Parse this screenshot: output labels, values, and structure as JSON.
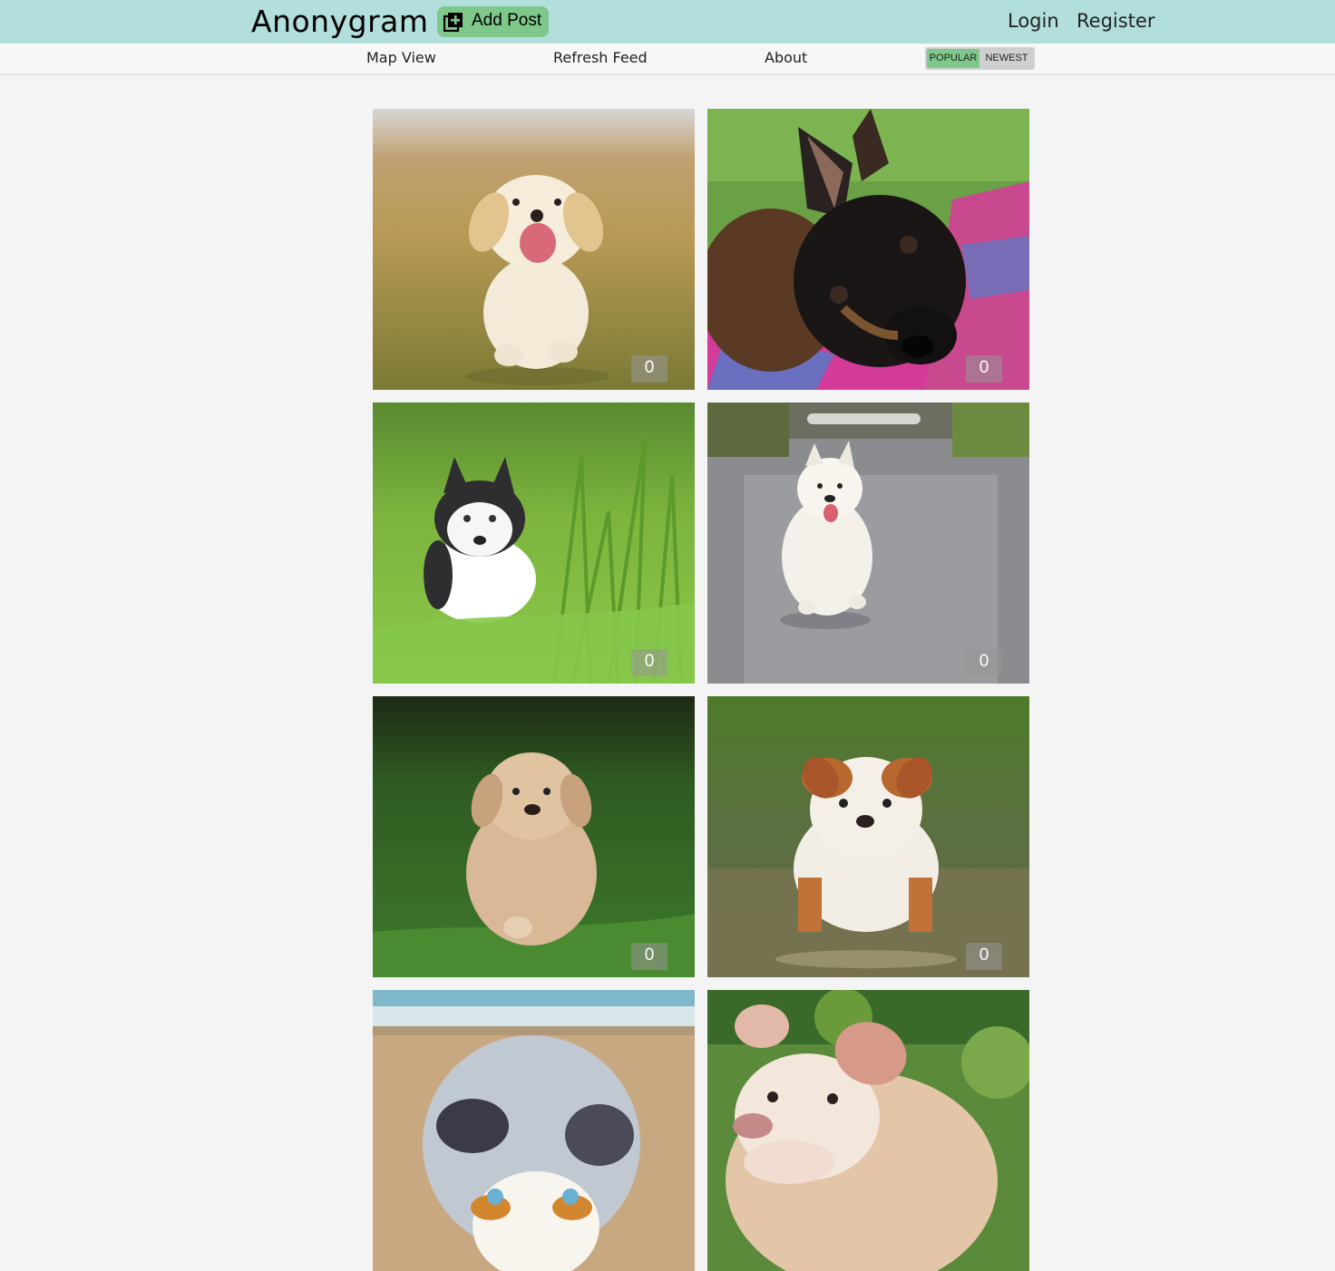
{
  "header": {
    "brand": "Anonygram",
    "add_post_label": "Add Post",
    "add_post_icon": "add-box-icon",
    "login_label": "Login",
    "register_label": "Register",
    "background": "#b2dfdb",
    "accent": "#7dc88a"
  },
  "subnav": {
    "map_view_label": "Map View",
    "refresh_label": "Refresh Feed",
    "about_label": "About",
    "sort_options": [
      "POPULAR",
      "NEWEST"
    ],
    "sort_selected": "POPULAR"
  },
  "feed": {
    "posts": [
      {
        "subject": "golden retriever puppy running in grass",
        "votes": "0"
      },
      {
        "subject": "german shepherd puppy on pink blanket",
        "votes": "0"
      },
      {
        "subject": "husky puppy in tall green grass",
        "votes": "0"
      },
      {
        "subject": "white fluffy puppy walking on road",
        "votes": "0"
      },
      {
        "subject": "labrador puppy walking on grass",
        "votes": "0"
      },
      {
        "subject": "bulldog puppy standing in water",
        "votes": "0"
      },
      {
        "subject": "australian shepherd puppy on beach",
        "votes": ""
      },
      {
        "subject": "bulldog puppy in garden",
        "votes": ""
      }
    ]
  }
}
